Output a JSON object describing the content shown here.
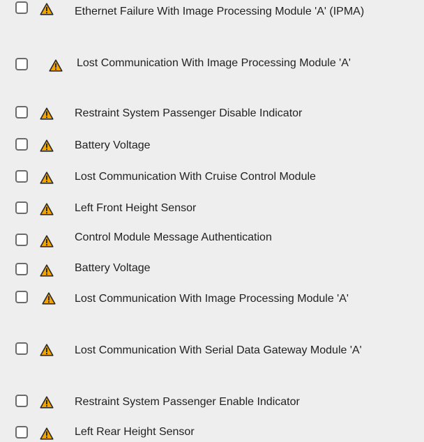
{
  "colors": {
    "background": "#eeeeee",
    "warning_fill": "#f5a400",
    "warning_outline": "#2b2b2b",
    "checkbox_border": "#6b6b6b",
    "text": "#222222"
  },
  "icons": {
    "checkbox": "checkbox-unchecked",
    "warning": "warning-triangle-icon"
  },
  "items": [
    {
      "label": "Ethernet Failure With Image Processing Module 'A' (IPMA)",
      "checked": false
    },
    {
      "label": "Lost Communication With Image Processing Module 'A'",
      "checked": false
    },
    {
      "label": "Restraint System Passenger Disable Indicator",
      "checked": false
    },
    {
      "label": "Battery Voltage",
      "checked": false
    },
    {
      "label": "Lost Communication With Cruise Control Module",
      "checked": false
    },
    {
      "label": "Left Front Height Sensor",
      "checked": false
    },
    {
      "label": "Control Module Message Authentication",
      "checked": false
    },
    {
      "label": "Battery Voltage",
      "checked": false
    },
    {
      "label": "Lost Communication With Image Processing Module 'A'",
      "checked": false
    },
    {
      "label": "Lost Communication With Serial Data Gateway Module 'A'",
      "checked": false
    },
    {
      "label": "Restraint System Passenger Enable Indicator",
      "checked": false
    },
    {
      "label": "Left Rear Height Sensor",
      "checked": false
    }
  ]
}
